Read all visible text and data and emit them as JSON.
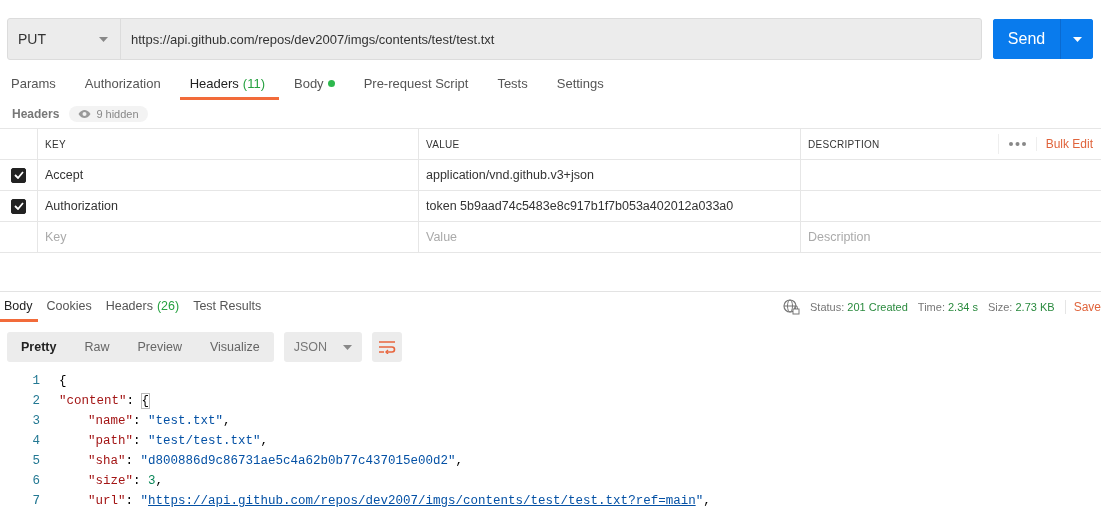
{
  "request": {
    "method": "PUT",
    "url": "https://api.github.com/repos/dev2007/imgs/contents/test/test.txt",
    "send": "Send"
  },
  "request_tabs": [
    {
      "label": "Params",
      "selected": false,
      "has_dot": false
    },
    {
      "label": "Authorization",
      "selected": false,
      "has_dot": false
    },
    {
      "label": "Headers",
      "count": "(11)",
      "selected": true,
      "has_dot": false
    },
    {
      "label": "Body",
      "selected": false,
      "has_dot": true
    },
    {
      "label": "Pre-request Script",
      "selected": false,
      "has_dot": false
    },
    {
      "label": "Tests",
      "selected": false,
      "has_dot": false
    },
    {
      "label": "Settings",
      "selected": false,
      "has_dot": false
    }
  ],
  "headers_bar": {
    "title": "Headers",
    "hidden": "9 hidden"
  },
  "headers_table": {
    "columns": [
      "KEY",
      "VALUE",
      "DESCRIPTION"
    ],
    "bulk_edit": "Bulk Edit",
    "rows": [
      {
        "kind": "entry",
        "checked": true,
        "key": "Accept",
        "value": "application/vnd.github.v3+json"
      },
      {
        "kind": "entry",
        "checked": true,
        "key": "Authorization",
        "value": "token 5b9aad74c5483e8c917b1f7b053a402012a033a0"
      },
      {
        "kind": "new",
        "key": {
          "placeholder": "Key"
        },
        "value": {
          "placeholder": "Value"
        },
        "description": {
          "placeholder": "Description"
        }
      }
    ]
  },
  "response_tabs": [
    {
      "label": "Body",
      "selected": true
    },
    {
      "label": "Cookies",
      "selected": false
    },
    {
      "label": "Headers",
      "count": "(26)",
      "selected": false
    },
    {
      "label": "Test Results",
      "selected": false
    }
  ],
  "response_meta": [
    {
      "label": "Status:",
      "value": "201 Created"
    },
    {
      "label": "Time:",
      "value": "2.34 s"
    },
    {
      "label": "Size:",
      "value": "2.73 KB"
    }
  ],
  "save": "Save",
  "view_modes": [
    {
      "label": "Pretty",
      "selected": true
    },
    {
      "label": "Raw",
      "selected": false
    },
    {
      "label": "Preview",
      "selected": false
    },
    {
      "label": "Visualize",
      "selected": false
    }
  ],
  "format": "JSON",
  "code_lines": [
    {
      "number": "1",
      "tokens": [
        {
          "kind": "punct",
          "text": "{"
        }
      ]
    },
    {
      "number": "2",
      "tokens": [
        {
          "kind": "key",
          "text": "\"content\""
        },
        {
          "kind": "punct",
          "text": ": "
        },
        {
          "kind": "bracket",
          "text": "{"
        }
      ],
      "children": [
        {
          "number": "3",
          "tokens": [
            {
              "kind": "key",
              "text": "\"name\""
            },
            {
              "kind": "punct",
              "text": ": "
            },
            {
              "kind": "string",
              "text": "\"test.txt\""
            },
            {
              "kind": "punct",
              "text": ","
            }
          ]
        },
        {
          "number": "4",
          "tokens": [
            {
              "kind": "key",
              "text": "\"path\""
            },
            {
              "kind": "punct",
              "text": ": "
            },
            {
              "kind": "string",
              "text": "\"test/test.txt\""
            },
            {
              "kind": "punct",
              "text": ","
            }
          ]
        },
        {
          "number": "5",
          "tokens": [
            {
              "kind": "key",
              "text": "\"sha\""
            },
            {
              "kind": "punct",
              "text": ": "
            },
            {
              "kind": "string",
              "text": "\"d800886d9c86731ae5c4a62b0b77c437015e00d2\""
            },
            {
              "kind": "punct",
              "text": ","
            }
          ]
        },
        {
          "number": "6",
          "tokens": [
            {
              "kind": "key",
              "text": "\"size\""
            },
            {
              "kind": "punct",
              "text": ": "
            },
            {
              "kind": "number",
              "text": "3"
            },
            {
              "kind": "punct",
              "text": ","
            }
          ]
        },
        {
          "number": "7",
          "tokens": [
            {
              "kind": "key",
              "text": "\"url\""
            },
            {
              "kind": "punct",
              "text": ": "
            },
            {
              "kind": "string",
              "text": "\""
            },
            {
              "kind": "link",
              "text": "https://api.github.com/repos/dev2007/imgs/contents/test/test.txt?ref=main"
            },
            {
              "kind": "string",
              "text": "\""
            },
            {
              "kind": "punct",
              "text": ","
            }
          ]
        }
      ]
    }
  ]
}
